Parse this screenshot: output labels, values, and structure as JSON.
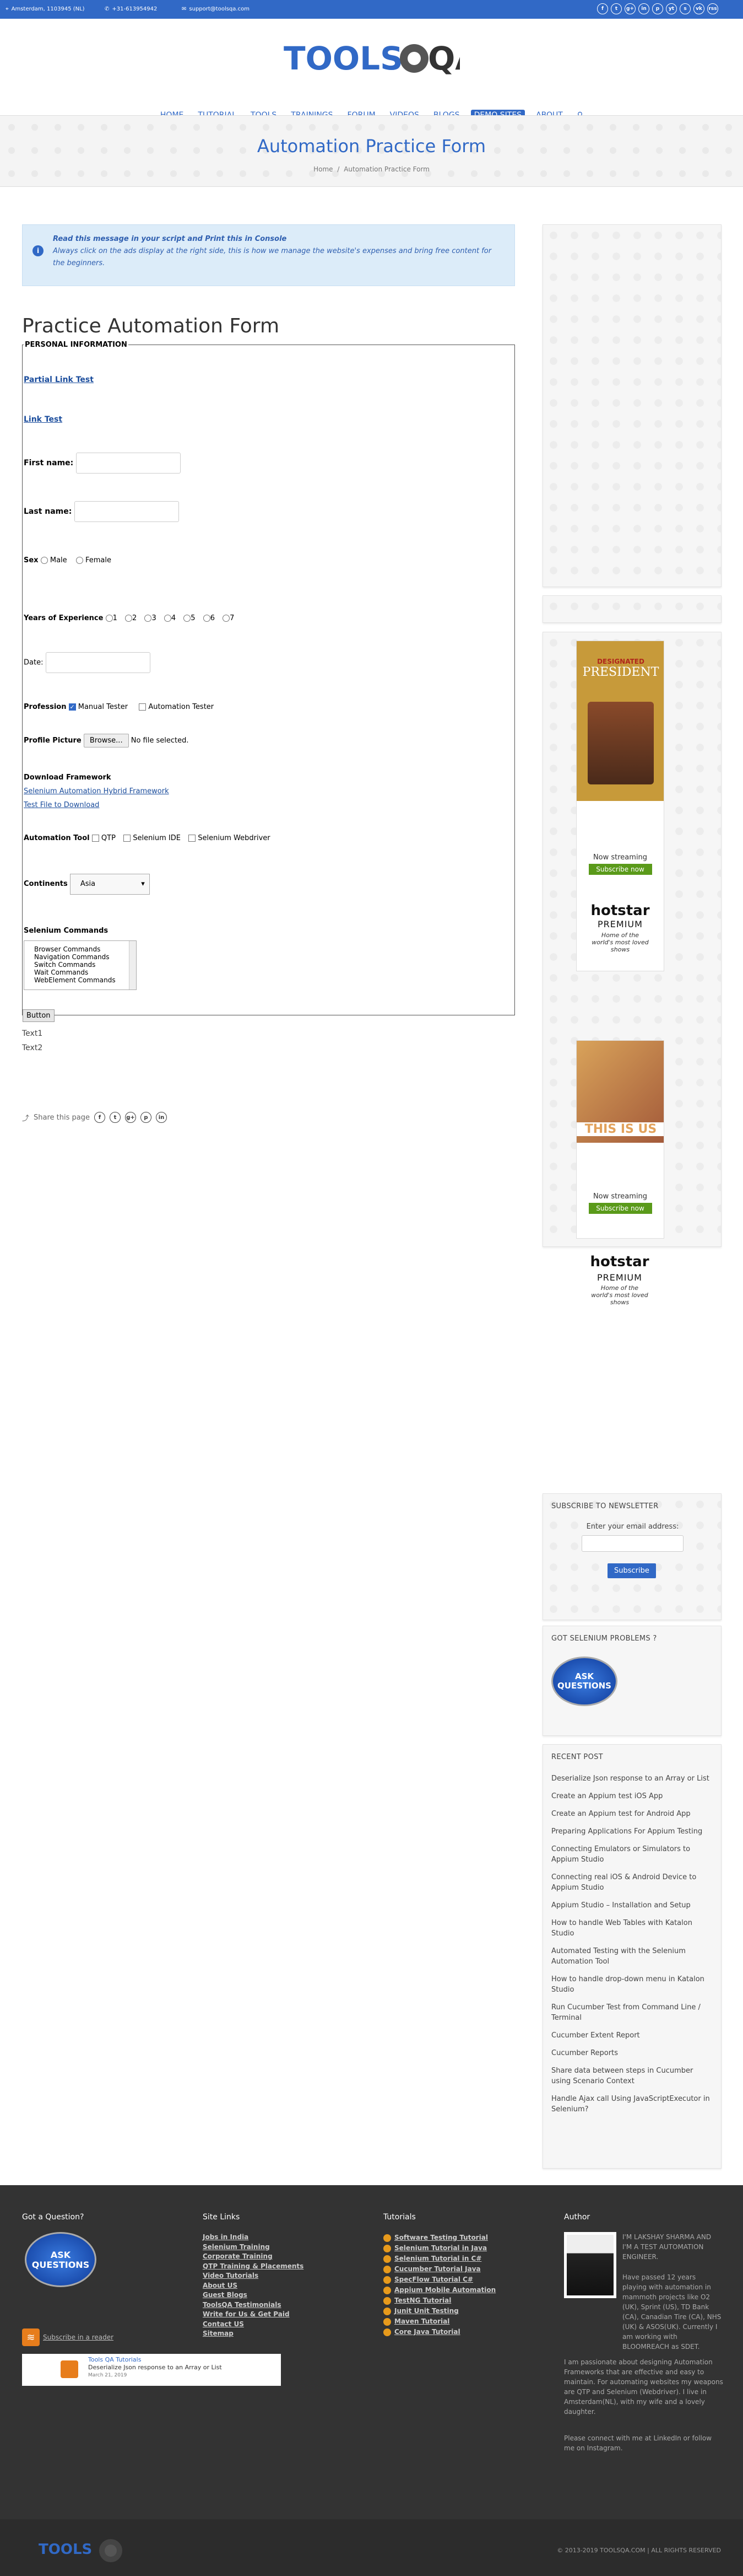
{
  "topbar": {
    "address": "Amsterdam, 1103945 (NL)",
    "phone": "+31-613954942",
    "email": "support@toolsqa.com",
    "social": [
      "f",
      "t",
      "g+",
      "in",
      "p",
      "yt",
      "s",
      "vk",
      "rss"
    ]
  },
  "logo": {
    "text_left": "TOOLS",
    "text_right": "QA"
  },
  "nav": [
    "HOME",
    "TUTORIAL",
    "TOOLS",
    "TRAININGS",
    "FORUM",
    "VIDEOS",
    "BLOGS",
    "DEMO SITES",
    "ABOUT"
  ],
  "banner": {
    "title": "Automation Practice Form",
    "crumb_home": "Home",
    "crumb_sep": "/",
    "crumb_current": "Automation Practice Form"
  },
  "info": {
    "line1": "Read this message in your script and Print this in Console",
    "line2": "Always click on the ads display at the right side, this is how we manage the website's expenses and bring free content for the beginners."
  },
  "form": {
    "title": "Practice Automation Form",
    "legend": "PERSONAL INFORMATION",
    "partial_link": "Partial Link Test",
    "link_test": "Link Test",
    "first_name": "First name:",
    "last_name": "Last name:",
    "sex": "Sex",
    "sex_options": [
      "Male",
      "Female"
    ],
    "years": "Years of Experience",
    "years_options": [
      "1",
      "2",
      "3",
      "4",
      "5",
      "6",
      "7"
    ],
    "date": "Date:",
    "profession": "Profession",
    "profession_options": [
      "Manual Tester",
      "Automation Tester"
    ],
    "profile_picture": "Profile Picture",
    "browse": "Browse...",
    "no_file": "No file selected.",
    "download": "Download Framework",
    "download_links": [
      "Selenium Automation Hybrid Framework",
      "Test File to Download"
    ],
    "automation_tool": "Automation Tool",
    "tool_options": [
      "QTP",
      "Selenium IDE",
      "Selenium Webdriver"
    ],
    "continents": "Continents",
    "continent_selected": "Asia",
    "selenium_commands": "Selenium Commands",
    "command_options": [
      "Browser Commands",
      "Navigation Commands",
      "Switch Commands",
      "Wait Commands",
      "WebElement Commands"
    ],
    "button": "Button"
  },
  "texts": [
    "Text1",
    "Text2"
  ],
  "share": {
    "label": "Share this page",
    "icons": [
      "f",
      "t",
      "g+",
      "p",
      "in"
    ]
  },
  "ads": [
    {
      "brand_top": "DESIGNATED",
      "headline": "PRESIDENT",
      "streaming": "Now streaming",
      "subscribe": "Subscribe now",
      "hotstar": "hotstar",
      "premium": "PREMIUM",
      "tagline": "Home of the world's most loved shows"
    },
    {
      "brand_top": "THIS IS US",
      "headline": "",
      "streaming": "Now streaming",
      "subscribe": "Subscribe now",
      "hotstar": "hotstar",
      "premium": "PREMIUM",
      "tagline": "Home of the world's most loved shows"
    }
  ],
  "newsletter": {
    "title": "SUBSCRIBE TO NEWSLETTER",
    "label": "Enter your email address:",
    "button": "Subscribe"
  },
  "problems": {
    "title": "GOT SELENIUM PROBLEMS ?",
    "badge_line1": "ASK",
    "badge_line2": "QUESTIONS"
  },
  "recent": {
    "title": "RECENT POST",
    "items": [
      "Deserialize Json response to an Array or List",
      "Create an Appium test iOS App",
      "Create an Appium test for Android App",
      "Preparing Applications For Appium Testing",
      "Connecting Emulators or Simulators to Appium Studio",
      "Connecting real iOS & Android Device to Appium Studio",
      "Appium Studio – Installation and Setup",
      "How to handle Web Tables with Katalon Studio",
      "Automated Testing with the Selenium Automation Tool",
      "How to handle drop-down menu in Katalon Studio",
      "Run Cucumber Test from Command Line / Terminal",
      "Cucumber Extent Report",
      "Cucumber Reports",
      "Share data between steps in Cucumber using Scenario Context",
      "Handle Ajax call Using JavaScriptExecutor in Selenium?"
    ]
  },
  "footer": {
    "question": {
      "title": "Got a Question?",
      "badge_line1": "ASK",
      "badge_line2": "QUESTIONS",
      "rss": "Subscribe in a reader",
      "feed_title": "Tools QA Tutorials",
      "feed_item": "Deserialize Json response to an Array or List",
      "feed_date": "March 21, 2019"
    },
    "site_links": {
      "title": "Site Links",
      "items": [
        "Jobs in India",
        "Selenium Training",
        "Corporate Training",
        "QTP Training & Placements",
        "Video Tutorials",
        "About US",
        "Guest Blogs",
        "ToolsQA Testimonials",
        "Write for Us & Get Paid",
        "Contact US",
        "Sitemap"
      ]
    },
    "tutorials": {
      "title": "Tutorials",
      "items": [
        "Software Testing Tutorial",
        "Selenium Tutorial in Java",
        "Selenium Tutorial in C#",
        "Cucumber Tutorial Java",
        "SpecFlow Tutorial C#",
        "Appium Mobile Automation",
        "TestNG Tutorial",
        "Junit Unit Testing",
        "Maven Tutorial",
        "Core Java Tutorial"
      ]
    },
    "author": {
      "title": "Author",
      "bio1": "I'M LAKSHAY SHARMA AND I'M A TEST AUTOMATION ENGINEER.",
      "bio2": "Have passed 12 years playing with automation in mammoth projects like O2 (UK), Sprint (US), TD Bank (CA), Canadian Tire (CA), NHS (UK) & ASOS(UK). Currently I am working with BLOOMREACH as SDET.",
      "bio3": "I am passionate about designing Automation Frameworks that are effective and easy to maintain. For automating websites my weapons are QTP and Selenium (Webdriver). I live in Amsterdam(NL), with my wife and a lovely daughter.",
      "bio4": "Please connect with me at LinkedIn or follow me on Instagram."
    },
    "copyright": "© 2013-2019 TOOLSQA.COM | ALL RIGHTS RESERVED",
    "logo": "TOOLS"
  },
  "colors": {
    "brand": "#3169c6",
    "accent": "#e79a1c"
  }
}
